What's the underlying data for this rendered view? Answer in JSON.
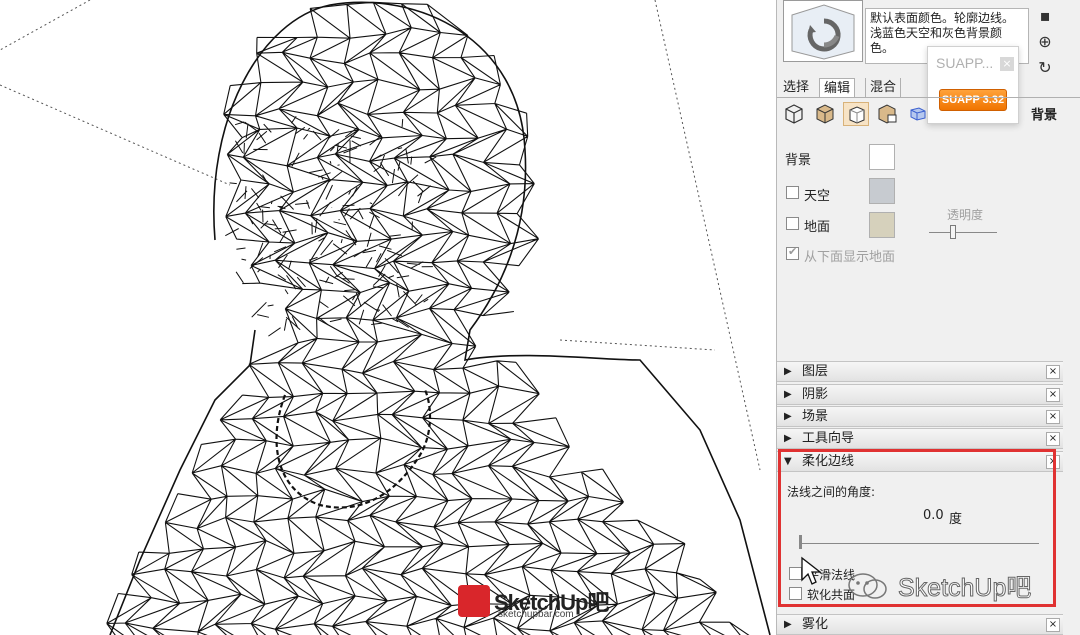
{
  "style_panel": {
    "description": "默认表面颜色。轮廓边线。浅蓝色天空和灰色背景颜色。",
    "suapp_popup_title": "SUAPP...",
    "suapp_version": "SUAPP 3.32"
  },
  "tabs": [
    {
      "label": "选择",
      "active": false
    },
    {
      "label": "编辑",
      "active": true
    },
    {
      "label": "混合",
      "active": false
    }
  ],
  "face_buttons": [
    "edge-settings-icon",
    "face-settings-icon",
    "background-settings-icon",
    "watermark-settings-icon",
    "modeling-settings-icon"
  ],
  "section_title": "背景",
  "background": {
    "bg_label": "背景",
    "bg_color": "#ffffff",
    "sky_label": "天空",
    "sky_checked": false,
    "sky_color": "#c7cbd0",
    "ground_label": "地面",
    "ground_checked": false,
    "ground_color": "#d6d1bc",
    "transparency_label": "透明度",
    "transparency_value": 0.35,
    "show_ground_below_label": "从下面显示地面",
    "show_ground_below_checked": true
  },
  "trays": [
    {
      "label": "图层",
      "expanded": false
    },
    {
      "label": "阴影",
      "expanded": false
    },
    {
      "label": "场景",
      "expanded": false
    },
    {
      "label": "工具向导",
      "expanded": false
    },
    {
      "label": "柔化边线",
      "expanded": true
    },
    {
      "label": "雾化",
      "expanded": false
    }
  ],
  "soften_edges": {
    "angle_label": "法线之间的角度:",
    "angle_value": "0.0",
    "angle_unit": "度",
    "slider_value": 0.0,
    "smooth_normals_label": "平滑法线",
    "smooth_normals_checked": false,
    "soften_coplanar_label": "软化共面",
    "soften_coplanar_checked": false
  },
  "icons": {
    "expanded": "▼",
    "collapsed": "▶",
    "close": "×",
    "arrows": "↻"
  },
  "watermark": {
    "logo_text": "SketchUp吧",
    "logo_url": "sketchupbar.com",
    "wechat_text": "SketchUp吧"
  },
  "colors": {
    "highlight": "#e03232",
    "suapp_orange": "#f07400"
  }
}
